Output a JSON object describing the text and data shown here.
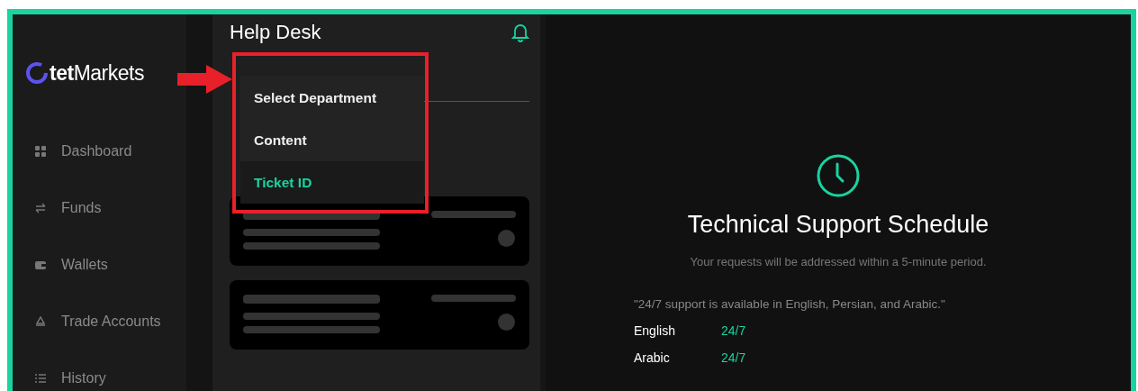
{
  "logo": {
    "text": "**tet**Markets"
  },
  "sidebar": {
    "items": [
      {
        "label": "Dashboard"
      },
      {
        "label": "Funds"
      },
      {
        "label": "Wallets"
      },
      {
        "label": "Trade Accounts"
      },
      {
        "label": "History"
      }
    ]
  },
  "help_desk": {
    "title": "Help Desk"
  },
  "search_menu": {
    "items": [
      {
        "label": "Select Department",
        "selected": false
      },
      {
        "label": "Content",
        "selected": false
      },
      {
        "label": "Ticket ID",
        "selected": true
      }
    ]
  },
  "schedule": {
    "title": "Technical Support Schedule",
    "subtitle": "Your requests will be addressed within a 5-minute period.",
    "note": "\"24/7 support is available in English, Persian, and Arabic.\"",
    "rows": [
      {
        "language": "English",
        "hours": "24/7"
      },
      {
        "language": "Arabic",
        "hours": "24/7"
      }
    ]
  }
}
